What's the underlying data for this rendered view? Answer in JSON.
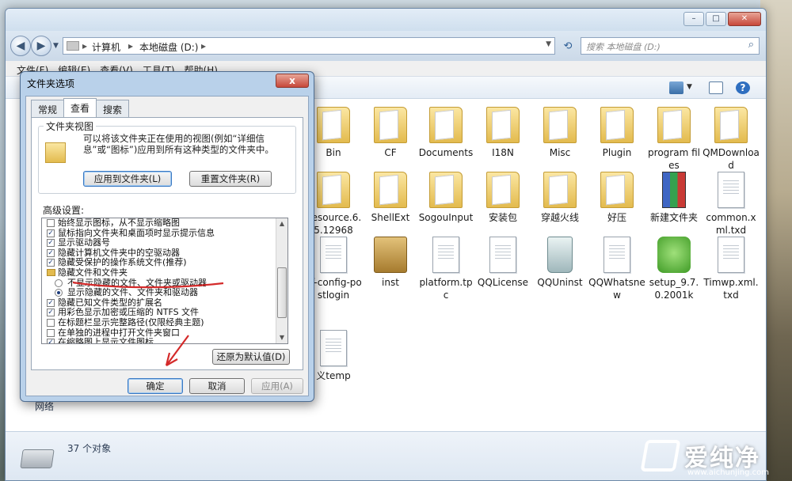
{
  "explorer": {
    "window_buttons": [
      "–",
      "□",
      "✕"
    ],
    "breadcrumb": [
      "计算机",
      "本地磁盘 (D:)"
    ],
    "search_placeholder": "搜索 本地磁盘 (D:)",
    "menu": [
      "文件(F)",
      "编辑(E)",
      "查看(V)",
      "工具(T)",
      "帮助(H)"
    ],
    "nav_fragment": "网络",
    "status_count": "37 个对象",
    "items": [
      {
        "label": "Bin",
        "icon": "folder"
      },
      {
        "label": "CF",
        "icon": "folder"
      },
      {
        "label": "Documents",
        "icon": "folder"
      },
      {
        "label": "I18N",
        "icon": "folder"
      },
      {
        "label": "Misc",
        "icon": "folder"
      },
      {
        "label": "Plugin",
        "icon": "folder"
      },
      {
        "label": "program files",
        "icon": "folder"
      },
      {
        "label": "QMDownload",
        "icon": "folder"
      },
      {
        "label": "Resource.6.5.12968",
        "icon": "folder"
      },
      {
        "label": "ShellExt",
        "icon": "folder"
      },
      {
        "label": "SogouInput",
        "icon": "folder"
      },
      {
        "label": "安装包",
        "icon": "folder"
      },
      {
        "label": "穿越火线",
        "icon": "folder"
      },
      {
        "label": "好压",
        "icon": "folder"
      },
      {
        "label": "新建文件夹",
        "icon": "winrar"
      },
      {
        "label": "common.xml.txd",
        "icon": "doc"
      },
      {
        "label": "gf-config-postlogin",
        "icon": "doc"
      },
      {
        "label": "inst",
        "icon": "pkgbox"
      },
      {
        "label": "platform.tpc",
        "icon": "doc"
      },
      {
        "label": "QQLicense",
        "icon": "doc"
      },
      {
        "label": "QQUninst",
        "icon": "bin"
      },
      {
        "label": "QQWhatsnew",
        "icon": "doc"
      },
      {
        "label": "setup_9.7.0.2001k",
        "icon": "green"
      },
      {
        "label": "Timwp.xml.txd",
        "icon": "doc"
      },
      {
        "label": "义temp",
        "icon": "doc"
      }
    ]
  },
  "dialog": {
    "title": "文件夹选项",
    "close": "x",
    "tabs": [
      "常规",
      "查看",
      "搜索"
    ],
    "active_tab": "查看",
    "folder_view_label": "文件夹视图",
    "folder_view_desc": "可以将该文件夹正在使用的视图(例如“详细信息”或“图标”)应用到所有这种类型的文件夹中。",
    "apply_btn": "应用到文件夹(L)",
    "reset_btn": "重置文件夹(R)",
    "advanced_label": "高级设置:",
    "settings": [
      {
        "text": "始终显示图标，从不显示缩略图",
        "type": "checkbox",
        "checked": false
      },
      {
        "text": "鼠标指向文件夹和桌面项时显示提示信息",
        "type": "checkbox",
        "checked": true
      },
      {
        "text": "显示驱动器号",
        "type": "checkbox",
        "checked": true
      },
      {
        "text": "隐藏计算机文件夹中的空驱动器",
        "type": "checkbox",
        "checked": true
      },
      {
        "text": "隐藏受保护的操作系统文件(推荐)",
        "type": "checkbox",
        "checked": true
      },
      {
        "text": "隐藏文件和文件夹",
        "type": "folder",
        "checked": false
      },
      {
        "text": "不显示隐藏的文件、文件夹或驱动器",
        "type": "radio",
        "checked": false
      },
      {
        "text": "显示隐藏的文件、文件夹和驱动器",
        "type": "radio",
        "checked": true
      },
      {
        "text": "隐藏已知文件类型的扩展名",
        "type": "checkbox",
        "checked": true
      },
      {
        "text": "用彩色显示加密或压缩的 NTFS 文件",
        "type": "checkbox",
        "checked": true
      },
      {
        "text": "在标题栏显示完整路径(仅限经典主题)",
        "type": "checkbox",
        "checked": false
      },
      {
        "text": "在单独的进程中打开文件夹窗口",
        "type": "checkbox",
        "checked": false
      },
      {
        "text": "在缩略图上显示文件图标",
        "type": "checkbox",
        "checked": true
      }
    ],
    "restore_btn": "还原为默认值(D)",
    "ok_btn": "确定",
    "cancel_btn": "取消",
    "apply_footer_btn": "应用(A)"
  },
  "watermark": {
    "brand": "爱纯净",
    "url": "www.aichunjing.com"
  },
  "colors": {
    "annotation_red": "#d42a2a",
    "title_blue": "#b9d1ea",
    "accent": "#3b79c2"
  }
}
